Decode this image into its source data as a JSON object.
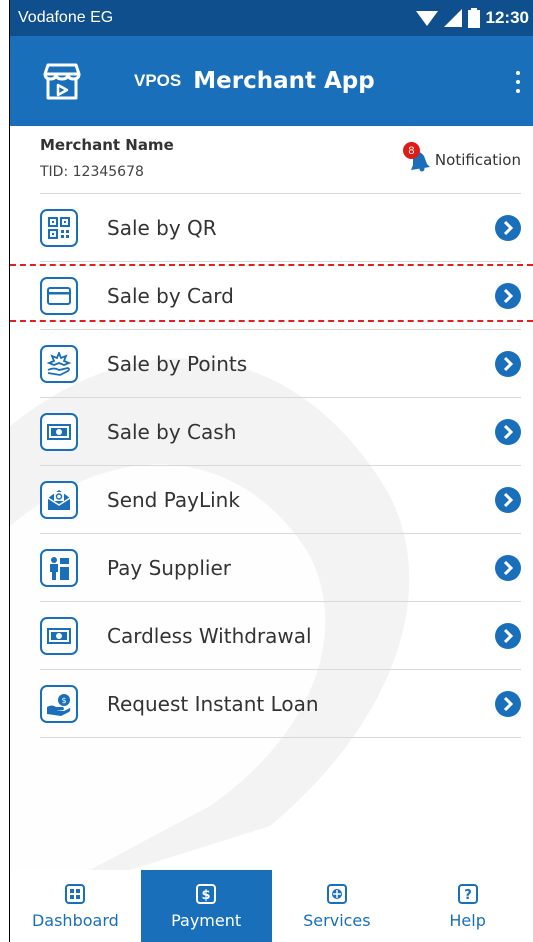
{
  "status_bar": {
    "carrier": "Vodafone EG",
    "time": "12:30",
    "icons": [
      "wifi-icon",
      "signal-icon",
      "battery-icon"
    ]
  },
  "app_bar": {
    "logo_icon": "store-icon",
    "brand": "VPOS",
    "title": "Merchant App",
    "menu_icon": "more-vert-icon"
  },
  "merchant": {
    "name": "Merchant Name",
    "tid": "TID: 12345678",
    "notification_label": "Notification",
    "notification_count": "8"
  },
  "menu": {
    "items": [
      {
        "label": "Sale by QR",
        "icon": "qr-code-icon"
      },
      {
        "label": "Sale by Card",
        "icon": "card-icon"
      },
      {
        "label": "Sale by Points",
        "icon": "points-icon"
      },
      {
        "label": "Sale by Cash",
        "icon": "cash-icon"
      },
      {
        "label": "Send PayLink",
        "icon": "paylink-icon"
      },
      {
        "label": "Pay Supplier",
        "icon": "supplier-icon"
      },
      {
        "label": "Cardless Withdrawal",
        "icon": "withdrawal-icon"
      },
      {
        "label": "Request Instant Loan",
        "icon": "loan-icon"
      }
    ]
  },
  "bottom_nav": {
    "items": [
      {
        "label": "Dashboard",
        "icon": "dashboard-icon",
        "active": false
      },
      {
        "label": "Payment",
        "icon": "payment-icon",
        "active": true
      },
      {
        "label": "Services",
        "icon": "services-icon",
        "active": false
      },
      {
        "label": "Help",
        "icon": "help-icon",
        "active": false
      }
    ]
  },
  "colors": {
    "status_bar": "#0f4f8e",
    "app_bar": "#1a6fba",
    "accent": "#1a6fba",
    "badge": "#e01919",
    "highlight_dash": "#e02020"
  }
}
